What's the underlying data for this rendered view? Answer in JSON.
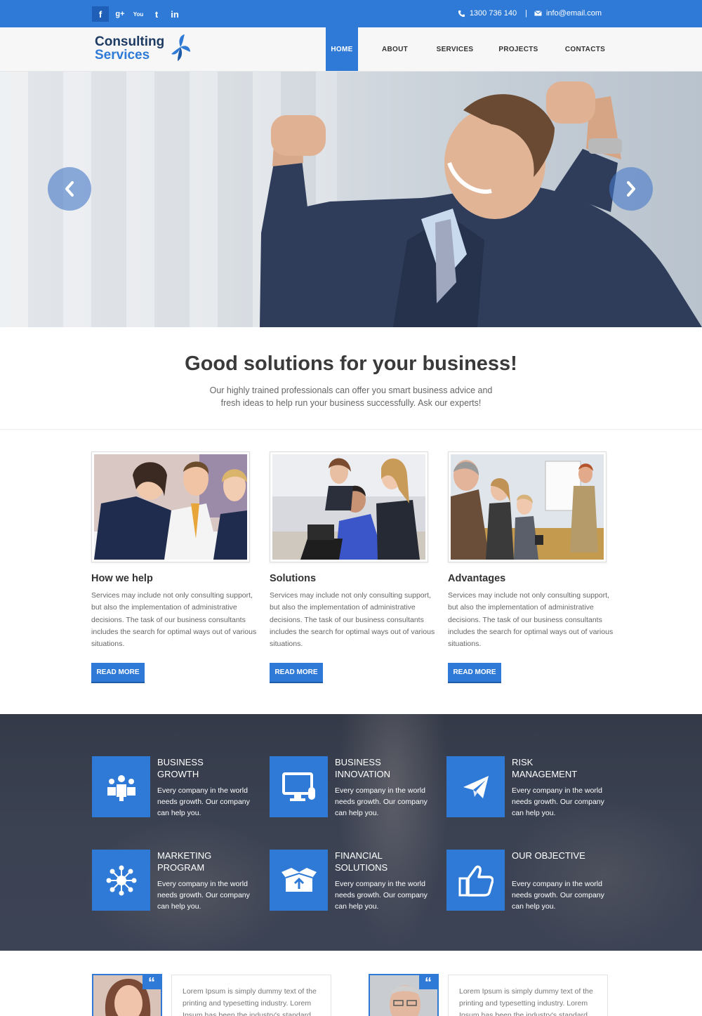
{
  "topbar": {
    "socials": [
      {
        "icon": "facebook-icon",
        "glyph": "f"
      },
      {
        "icon": "google-plus-icon",
        "glyph": "g+"
      },
      {
        "icon": "youtube-icon",
        "glyph": "You"
      },
      {
        "icon": "twitter-icon",
        "glyph": "t"
      },
      {
        "icon": "linkedin-icon",
        "glyph": "in"
      }
    ],
    "phone": "1300 736 140",
    "separator": "|",
    "email": "info@email.com"
  },
  "header": {
    "logo_line1": "Consulting",
    "logo_line2": "Services",
    "nav": [
      "HOME",
      "ABOUT",
      "SERVICES",
      "PROJECTS",
      "CONTACTS"
    ]
  },
  "intro": {
    "title": "Good solutions for your business!",
    "text": "Our highly trained professionals can offer you smart business advice and fresh ideas to help run your business successfully. Ask our experts!"
  },
  "features": [
    {
      "title": "How we help",
      "text": "Services may include not only consulting support, but also the implementation of administrative decisions. The task of our business consultants includes the search for optimal ways out of various situations.",
      "button": "READ MORE"
    },
    {
      "title": "Solutions",
      "text": "Services may include not only consulting support, but also the implementation of administrative decisions. The task of our business consultants includes the search for optimal ways out of various situations.",
      "button": "READ MORE"
    },
    {
      "title": "Advantages",
      "text": "Services may include not only consulting support, but also the implementation of administrative decisions. The task of our business consultants includes the search for optimal ways out of various situations.",
      "button": "READ MORE"
    }
  ],
  "services": [
    {
      "title": "BUSINESS GROWTH",
      "text": "Every company in the world needs growth. Our company can help you.",
      "icon": "team-icon"
    },
    {
      "title": "BUSINESS INNOVATION",
      "text": "Every company in the world needs growth. Our company can help you.",
      "icon": "computer-icon"
    },
    {
      "title": "RISK MANAGEMENT",
      "text": "Every company in the world needs growth. Our company can help you.",
      "icon": "paper-plane-icon"
    },
    {
      "title": "MARKETING PROGRAM",
      "text": "Every company in the world needs growth. Our company can help you.",
      "icon": "network-icon"
    },
    {
      "title": "FINANCIAL SOLUTIONS",
      "text": "Every company in the world needs growth. Our company can help you.",
      "icon": "open-box-icon"
    },
    {
      "title": "OUR OBJECTIVE",
      "text": "Every company in the world needs growth. Our company can help you.",
      "icon": "thumbs-up-icon"
    }
  ],
  "testimonials": [
    {
      "quote_mark": "“",
      "text": "Lorem Ipsum is simply dummy text of the printing and typesetting industry. Lorem Ipsum has been the industry's standard"
    },
    {
      "quote_mark": "“",
      "text": "Lorem Ipsum is simply dummy text of the printing and typesetting industry. Lorem Ipsum has been the industry's standard"
    }
  ],
  "colors": {
    "accent": "#2e7ad6",
    "dark_band": "#3b4252",
    "heading": "#3a3a3a"
  }
}
